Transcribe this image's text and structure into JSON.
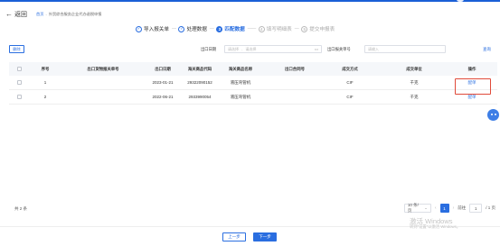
{
  "colors": {
    "accent": "#2a6ee0",
    "highlight": "#e04a3a",
    "header_bg": "#f5f7fa"
  },
  "header": {
    "back_label": "返回",
    "breadcrumb": {
      "home": "首页",
      "separator": "·",
      "current": "外贸综合服务企业代办退税申报"
    }
  },
  "steps": [
    {
      "num": "✓",
      "label": "导入报关单",
      "state": "done"
    },
    {
      "num": "✓",
      "label": "处理数据",
      "state": "done"
    },
    {
      "num": "3",
      "label": "匹配数据",
      "state": "active"
    },
    {
      "num": "4",
      "label": "填写明细表",
      "state": "todo"
    },
    {
      "num": "5",
      "label": "提交申报表",
      "state": "todo"
    }
  ],
  "filters": {
    "delete_label": "删除",
    "export_date_label": "出口日期",
    "start_placeholder": "请选择",
    "end_placeholder": "请选择",
    "calendar_icon": "calendar-icon",
    "bill_no_label": "出口报关单号",
    "bill_no_placeholder": "请输入",
    "query_label": "查询"
  },
  "table": {
    "columns": [
      "序号",
      "出口货物报关单号",
      "出口日期",
      "海关商品代码",
      "海关商品名称",
      "出口合同号",
      "成交方式",
      "成交单位",
      "操作"
    ],
    "rows": [
      {
        "no": "1",
        "bill": "",
        "date": "2023-01-21",
        "code": "29322090152",
        "name": "液压弯管机",
        "contract": "",
        "mode": "CIF",
        "unit": "千克",
        "op": "配单"
      },
      {
        "no": "2",
        "bill": "",
        "date": "2022-06-21",
        "code": "2933990054",
        "name": "液压弯管机",
        "contract": "",
        "mode": "CIF",
        "unit": "千克",
        "op": "配单"
      }
    ]
  },
  "pagination": {
    "total": "共 2 条",
    "page_size": "10 条/页",
    "current_page": "1",
    "prev_icon": "chevron-left-icon",
    "next_icon": "chevron-right-icon",
    "goto_label": "前往",
    "goto_value": "1",
    "page_total": "/ 1 页"
  },
  "actions": {
    "prev_label": "上一步",
    "next_label": "下一步"
  },
  "watermark": {
    "line1": "激活 Windows",
    "line2": "转到\"设置\"以激活 Windows。"
  }
}
